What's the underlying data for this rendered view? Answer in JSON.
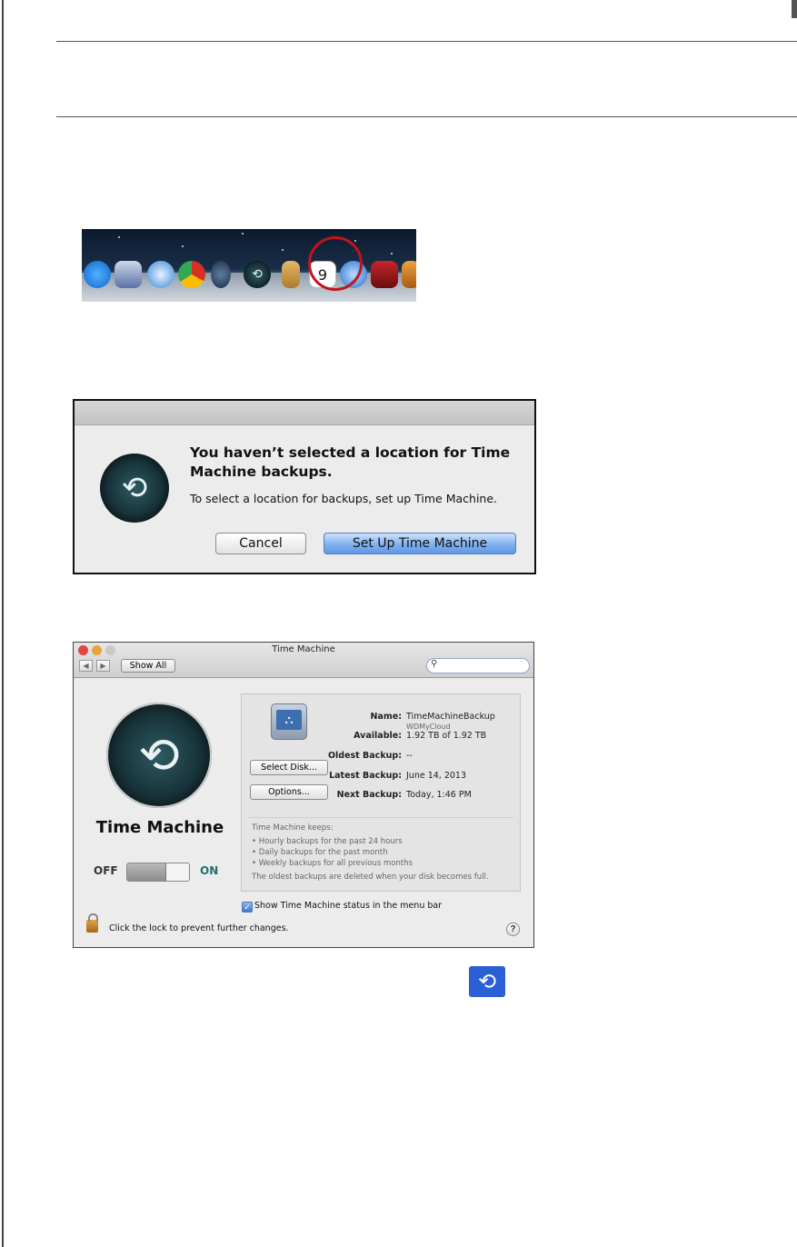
{
  "dialog": {
    "heading": "You haven’t selected a location for Time Machine backups.",
    "body": "To select a location for backups, set up Time Machine.",
    "cancel_label": "Cancel",
    "setup_label": "Set Up Time Machine"
  },
  "prefs": {
    "window_title": "Time Machine",
    "show_all_label": "Show All",
    "search_placeholder": "",
    "app_label": "Time Machine",
    "toggle_off_label": "OFF",
    "toggle_on_label": "ON",
    "toggle_state": "off",
    "disk": {
      "name_key": "Name:",
      "name_value": "TimeMachineBackup",
      "name_sub": "WDMyCloud",
      "available_key": "Available:",
      "available_value": "1.92 TB of 1.92 TB",
      "oldest_key": "Oldest Backup:",
      "oldest_value": "--",
      "latest_key": "Latest Backup:",
      "latest_value": "June 14, 2013",
      "next_key": "Next Backup:",
      "next_value": "Today, 1:46 PM"
    },
    "select_disk_label": "Select Disk...",
    "options_label": "Options...",
    "keeps": {
      "heading": "Time Machine keeps:",
      "items": [
        "• Hourly backups for the past 24 hours",
        "• Daily backups for the past month",
        "• Weekly backups for all previous months"
      ],
      "footer": "The oldest backups are deleted when your disk becomes full."
    },
    "status_checkbox_label": "Show Time Machine status in the menu bar",
    "status_checkbox_checked": true,
    "lock_label": "Click the lock to prevent further changes.",
    "help_label": "?"
  },
  "dock": {
    "icons": [
      "app-store-icon",
      "preview-icon",
      "safari-icon",
      "chrome-icon",
      "mission-control-icon",
      "time-machine-icon",
      "contacts-icon",
      "calendar-icon",
      "itunes-icon",
      "photo-booth-icon",
      "iphoto-icon"
    ],
    "calendar_day": "9",
    "highlight_color": "#c0141c"
  },
  "menubar_icon": "time-machine-menubar-icon",
  "colors": {
    "primary_button": "#7fb0ef",
    "menubar_icon_bg": "#2b5fd6",
    "on_label": "#1f6f6e"
  }
}
